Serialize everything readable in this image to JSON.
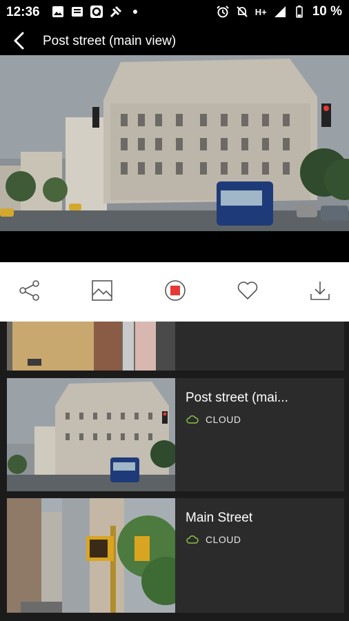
{
  "status_bar": {
    "time": "12:36",
    "battery": "10 %",
    "network": "H+"
  },
  "app_bar": {
    "title": "Post street (main view)"
  },
  "actions": [
    {
      "icon": "share-icon"
    },
    {
      "icon": "image-icon"
    },
    {
      "icon": "stop-record-icon"
    },
    {
      "icon": "heart-icon"
    },
    {
      "icon": "download-icon"
    }
  ],
  "cameras": [
    {
      "title": "Post street (mai...",
      "storage": "CLOUD"
    },
    {
      "title": "Main Street",
      "storage": "CLOUD"
    }
  ],
  "colors": {
    "accent_green": "#8bc34a",
    "record_red": "#e53935",
    "background": "#1b1b1b",
    "card": "#2b2b2b"
  }
}
